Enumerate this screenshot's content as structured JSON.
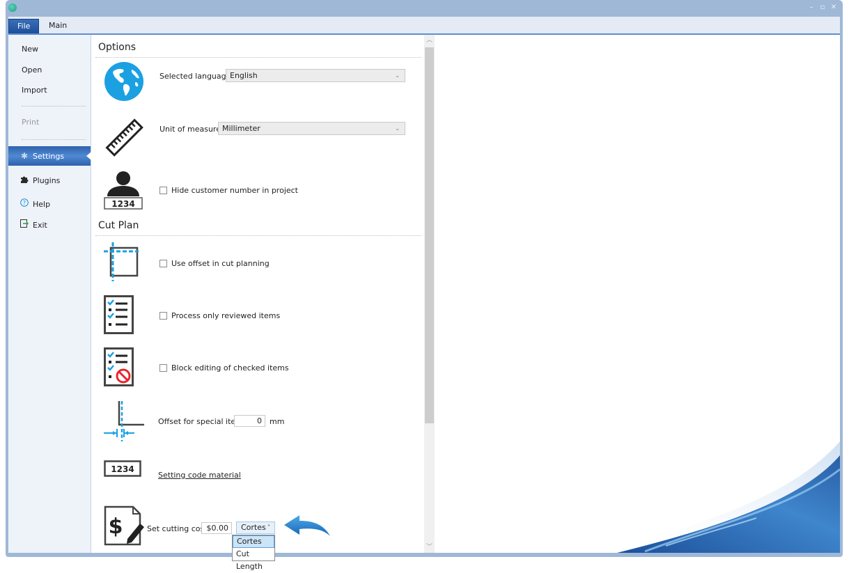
{
  "window": {
    "controls": {
      "minimize": "–",
      "maximize": "▫",
      "close": "✕"
    }
  },
  "tabs": [
    {
      "label": "File",
      "active": true
    },
    {
      "label": "Main",
      "active": false
    }
  ],
  "sidebar": {
    "items": [
      {
        "label": "New",
        "icon": ""
      },
      {
        "label": "Open",
        "icon": ""
      },
      {
        "label": "Import",
        "icon": ""
      },
      {
        "label": "Print",
        "icon": "",
        "disabled": true
      },
      {
        "label": "Settings",
        "icon": "gear-icon",
        "active": true
      },
      {
        "label": "Plugins",
        "icon": "puzzle-icon"
      },
      {
        "label": "Help",
        "icon": "help-icon"
      },
      {
        "label": "Exit",
        "icon": "exit-icon"
      }
    ]
  },
  "options": {
    "title": "Options",
    "language": {
      "label": "Selected language:",
      "value": "English"
    },
    "unit": {
      "label": "Unit of measure:",
      "value": "Millimeter"
    },
    "hide_customer": {
      "label": "Hide customer number in project",
      "checked": false,
      "icon_text": "1234"
    }
  },
  "cutplan": {
    "title": "Cut Plan",
    "use_offset": {
      "label": "Use offset in cut planning",
      "checked": false
    },
    "process_reviewed": {
      "label": "Process only reviewed items",
      "checked": false
    },
    "block_editing": {
      "label": "Block editing of checked items",
      "checked": false
    },
    "offset_special": {
      "label": "Offset for special item",
      "value": "0",
      "unit": "mm"
    },
    "code_material": {
      "label": "Setting code material",
      "icon_text": "1234"
    },
    "cutting_cost": {
      "label": "Set cutting cost",
      "value": "$0.00",
      "mode": "Cortes",
      "options": [
        "Cortes",
        "Cut Length"
      ],
      "highlighted": "Cortes"
    }
  },
  "colors": {
    "accent": "#1ba1e2",
    "titlebar": "#9fb8d6",
    "active_tab": "#2e62ad"
  }
}
